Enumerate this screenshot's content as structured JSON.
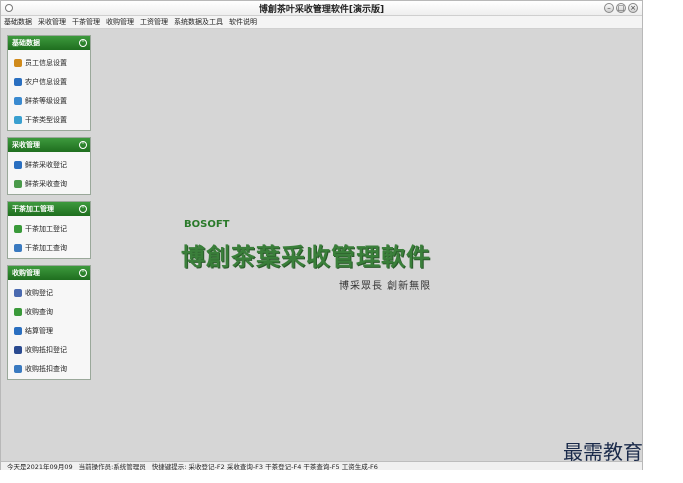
{
  "window": {
    "title": "博創茶叶采收管理软件[演示版]"
  },
  "menu": [
    "基础数据",
    "采收管理",
    "干茶管理",
    "收购管理",
    "工资管理",
    "系统数据及工具",
    "软件说明"
  ],
  "sidebar": {
    "groups": [
      {
        "title": "基础数据",
        "items": [
          {
            "label": "员工信息设置",
            "icon": "user-icon",
            "color": "#d08a1a"
          },
          {
            "label": "农户信息设置",
            "icon": "farmer-icon",
            "color": "#2a6fc0"
          },
          {
            "label": "鲜茶等级设置",
            "icon": "grade-icon",
            "color": "#3a8ad0"
          },
          {
            "label": "干茶类型设置",
            "icon": "tea-type-icon",
            "color": "#3aa0d0"
          }
        ]
      },
      {
        "title": "采收管理",
        "items": [
          {
            "label": "鲜茶采收登记",
            "icon": "register-icon",
            "color": "#2a6fc0"
          },
          {
            "label": "鲜茶采收查询",
            "icon": "query-icon",
            "color": "#4a9a4a"
          }
        ]
      },
      {
        "title": "干茶加工管理",
        "items": [
          {
            "label": "干茶加工登记",
            "icon": "edit-icon",
            "color": "#3a9a3a"
          },
          {
            "label": "干茶加工查询",
            "icon": "search-icon",
            "color": "#3a7ac0"
          }
        ]
      },
      {
        "title": "收购管理",
        "items": [
          {
            "label": "收购登记",
            "icon": "purchase-icon",
            "color": "#4a6ab0"
          },
          {
            "label": "收购查询",
            "icon": "purchase-query-icon",
            "color": "#3a9a3a"
          },
          {
            "label": "结算管理",
            "icon": "settle-icon",
            "color": "#2a6fc0"
          },
          {
            "label": "收购抵扣登记",
            "icon": "deduct-icon",
            "color": "#2a4a90"
          },
          {
            "label": "收购抵扣查询",
            "icon": "deduct-query-icon",
            "color": "#3a7ac0"
          }
        ]
      }
    ]
  },
  "logo": {
    "brand_prefix": "B",
    "brand_mid": "O",
    "brand_suffix": "SOFT",
    "title": "博創茶葉采收管理軟件",
    "slogan": "博采眾長  創新無限"
  },
  "status": {
    "today": "今天是2021年09月09",
    "operator": "当前操作员:系统管理员",
    "shortcuts": "快捷键提示: 采收登记-F2  采收查询-F3  干茶登记-F4  干茶查询-F5  工资生成-F6"
  },
  "watermark": "最需教育"
}
